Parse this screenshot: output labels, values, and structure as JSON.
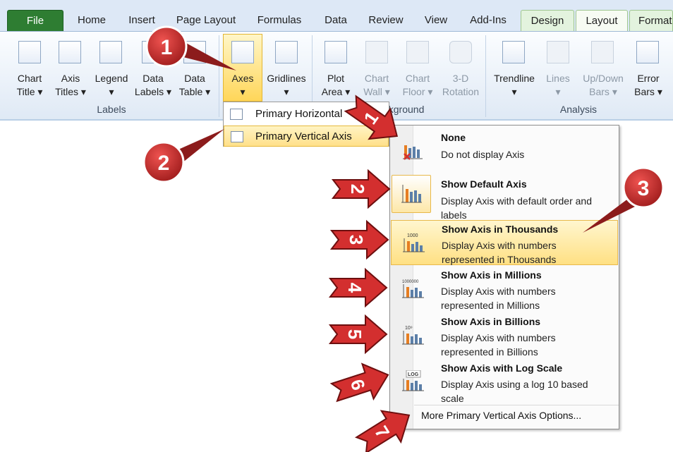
{
  "tabs": [
    {
      "label": "File"
    },
    {
      "label": "Home"
    },
    {
      "label": "Insert"
    },
    {
      "label": "Page Layout"
    },
    {
      "label": "Formulas"
    },
    {
      "label": "Data"
    },
    {
      "label": "Review"
    },
    {
      "label": "View"
    },
    {
      "label": "Add-Ins"
    },
    {
      "label": "Design"
    },
    {
      "label": "Layout"
    },
    {
      "label": "Format"
    }
  ],
  "ribbon": {
    "labels_group": "Labels",
    "background_group": "Background",
    "analysis_group": "Analysis",
    "buttons": {
      "chart_title": [
        "Chart",
        "Title ▾"
      ],
      "axis_titles": [
        "Axis",
        "Titles ▾"
      ],
      "legend": [
        "Legend",
        "▾"
      ],
      "data_labels": [
        "Data",
        "Labels ▾"
      ],
      "data_table": [
        "Data",
        "Table ▾"
      ],
      "axes": [
        "Axes",
        "▾"
      ],
      "gridlines": [
        "Gridlines",
        "▾"
      ],
      "plot_area": [
        "Plot",
        "Area ▾"
      ],
      "chart_wall": [
        "Chart",
        "Wall ▾"
      ],
      "chart_floor": [
        "Chart",
        "Floor ▾"
      ],
      "rotation_3d": [
        "3-D",
        "Rotation"
      ],
      "trendline": [
        "Trendline",
        "▾"
      ],
      "lines": [
        "Lines",
        "▾"
      ],
      "updown_bars": [
        "Up/Down",
        "Bars ▾"
      ],
      "error_bars": [
        "Error",
        "Bars ▾"
      ]
    }
  },
  "axes_submenu": [
    {
      "label": "Primary Horizontal Axis",
      "visible": "Primary Horizontal"
    },
    {
      "label": "Primary Vertical Axis"
    }
  ],
  "vertical_axis_menu": {
    "items": [
      {
        "title": "None",
        "desc": [
          "Do not display Axis"
        ],
        "icon": "no-axis-icon"
      },
      {
        "title": "Show Default Axis",
        "desc": [
          "Display Axis with default order and",
          "labels"
        ],
        "icon": "default-axis-icon"
      },
      {
        "title": "Show Axis in Thousands",
        "desc": [
          "Display Axis with numbers",
          "represented in Thousands"
        ],
        "icon": "thousands-axis-icon",
        "icon_text": "1000"
      },
      {
        "title": "Show Axis in Millions",
        "desc": [
          "Display Axis with numbers",
          "represented in Millions"
        ],
        "icon": "millions-axis-icon",
        "icon_text": "1000000"
      },
      {
        "title": "Show Axis in Billions",
        "desc": [
          "Display Axis with numbers",
          "represented in Billions"
        ],
        "icon": "billions-axis-icon",
        "icon_text": "10⁹"
      },
      {
        "title": "Show Axis with Log Scale",
        "desc": [
          "Display Axis using a log 10 based",
          "scale"
        ],
        "icon": "log-axis-icon",
        "icon_text": "LOG"
      }
    ],
    "more_options": "More Primary Vertical Axis Options..."
  },
  "callouts": {
    "badges": [
      "1",
      "2",
      "3"
    ],
    "arrows": [
      "1",
      "2",
      "3",
      "4",
      "5",
      "6",
      "7"
    ]
  },
  "colors": {
    "badge_red": "#c62828",
    "arrow_red": "#d32f2f",
    "highlight": "#ffe083",
    "file_tab": "#2e7d32"
  }
}
